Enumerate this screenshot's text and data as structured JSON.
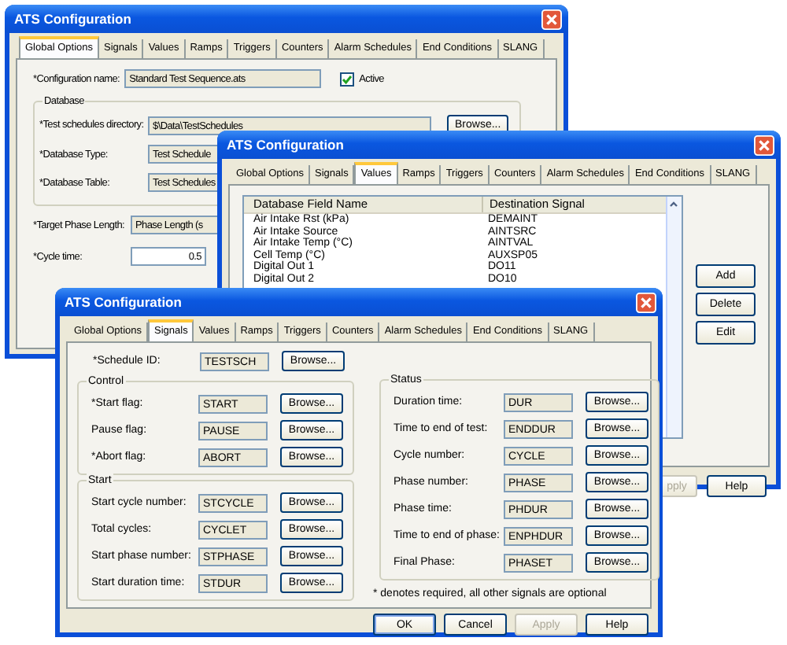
{
  "back_window": {
    "title": "ATS Configuration",
    "tabs": [
      {
        "label": "Global Options",
        "selected": true
      },
      {
        "label": "Signals",
        "selected": false
      },
      {
        "label": "Values",
        "selected": false
      },
      {
        "label": "Ramps",
        "selected": false
      },
      {
        "label": "Triggers",
        "selected": false
      },
      {
        "label": "Counters",
        "selected": false
      },
      {
        "label": "Alarm Schedules",
        "selected": false
      },
      {
        "label": "End Conditions",
        "selected": false
      },
      {
        "label": "SLANG",
        "selected": false
      }
    ],
    "configuration_name": {
      "label": "*Configuration name:",
      "value": "Standard Test Sequence.ats"
    },
    "active": {
      "label": "Active",
      "checked": true
    },
    "database": {
      "title": "Database",
      "fields": [
        {
          "label": "*Test schedules directory:",
          "value": "$\\Data\\TestSchedules",
          "button": "Browse..."
        },
        {
          "label": "*Database Type:",
          "value": "Test Schedule"
        },
        {
          "label": "*Database Table:",
          "value": "Test Schedules"
        }
      ]
    },
    "target_phase_length": {
      "label": "*Target Phase Length:",
      "value": "Phase Length (s"
    },
    "cycle_time": {
      "label": "*Cycle time:",
      "value": "0.5"
    }
  },
  "middle_window": {
    "title": "ATS Configuration",
    "tabs": [
      {
        "label": "Global Options",
        "selected": false
      },
      {
        "label": "Signals",
        "selected": false
      },
      {
        "label": "Values",
        "selected": true
      },
      {
        "label": "Ramps",
        "selected": false
      },
      {
        "label": "Triggers",
        "selected": false
      },
      {
        "label": "Counters",
        "selected": false
      },
      {
        "label": "Alarm Schedules",
        "selected": false
      },
      {
        "label": "End Conditions",
        "selected": false
      },
      {
        "label": "SLANG",
        "selected": false
      }
    ],
    "list": {
      "columns": [
        "Database Field Name",
        "Destination Signal"
      ],
      "rows": [
        [
          "Air Intake Rst (kPa)",
          "DEMAINT"
        ],
        [
          "Air Intake Source",
          "AINTSRC"
        ],
        [
          "Air Intake Temp (°C)",
          "AINTVAL"
        ],
        [
          "Cell Temp (°C)",
          "AUXSP05"
        ],
        [
          "Digital Out 1",
          "DO11"
        ],
        [
          "Digital Out 2",
          "DO10"
        ]
      ]
    },
    "buttons": [
      "Add",
      "Delete",
      "Edit"
    ],
    "footer_buttons": [
      {
        "label": "pply",
        "disabled": true
      },
      {
        "label": "Help",
        "disabled": false
      }
    ]
  },
  "front_window": {
    "title": "ATS Configuration",
    "tabs": [
      {
        "label": "Global Options",
        "selected": false
      },
      {
        "label": "Signals",
        "selected": true
      },
      {
        "label": "Values",
        "selected": false
      },
      {
        "label": "Ramps",
        "selected": false
      },
      {
        "label": "Triggers",
        "selected": false
      },
      {
        "label": "Counters",
        "selected": false
      },
      {
        "label": "Alarm Schedules",
        "selected": false
      },
      {
        "label": "End Conditions",
        "selected": false
      },
      {
        "label": "SLANG",
        "selected": false
      }
    ],
    "schedule_id": {
      "label": "*Schedule ID:",
      "value": "TESTSCH",
      "button": "Browse..."
    },
    "groups": [
      {
        "title": "Control",
        "rows": [
          {
            "label": "*Start flag:",
            "value": "START",
            "button": "Browse..."
          },
          {
            "label": "Pause flag:",
            "value": "PAUSE",
            "button": "Browse..."
          },
          {
            "label": "*Abort flag:",
            "value": "ABORT",
            "button": "Browse..."
          }
        ]
      },
      {
        "title": "Start",
        "rows": [
          {
            "label": "Start cycle number:",
            "value": "STCYCLE",
            "button": "Browse..."
          },
          {
            "label": "Total cycles:",
            "value": "CYCLET",
            "button": "Browse..."
          },
          {
            "label": "Start phase number:",
            "value": "STPHASE",
            "button": "Browse..."
          },
          {
            "label": "Start duration time:",
            "value": "STDUR",
            "button": "Browse..."
          }
        ]
      },
      {
        "title": "Status",
        "rows": [
          {
            "label": "Duration time:",
            "value": "DUR",
            "button": "Browse..."
          },
          {
            "label": "Time to end of test:",
            "value": "ENDDUR",
            "button": "Browse..."
          },
          {
            "label": "Cycle number:",
            "value": "CYCLE",
            "button": "Browse..."
          },
          {
            "label": "Phase number:",
            "value": "PHASE",
            "button": "Browse..."
          },
          {
            "label": "Phase time:",
            "value": "PHDUR",
            "button": "Browse..."
          },
          {
            "label": "Time to end of phase:",
            "value": "ENPHDUR",
            "button": "Browse..."
          },
          {
            "label": "Final Phase:",
            "value": "PHASET",
            "button": "Browse..."
          }
        ]
      }
    ],
    "note": "* denotes required, all other signals are optional",
    "buttons": [
      {
        "label": "OK",
        "disabled": false,
        "default": true
      },
      {
        "label": "Cancel",
        "disabled": false,
        "default": false
      },
      {
        "label": "Apply",
        "disabled": true,
        "default": false
      },
      {
        "label": "Help",
        "disabled": false,
        "default": false
      }
    ]
  }
}
